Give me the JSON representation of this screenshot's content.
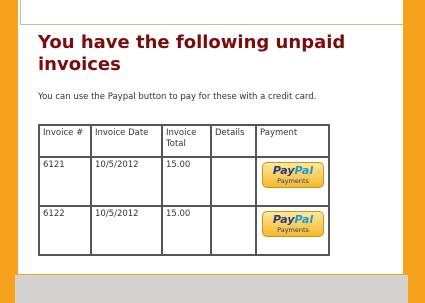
{
  "page": {
    "title": "You have the following unpaid invoices",
    "intro": "You can use the Paypal button to pay for these with a credit card."
  },
  "table": {
    "headers": [
      "Invoice #",
      "Invoice Date",
      "Invoice Total",
      "Details",
      "Payment"
    ],
    "rows": [
      {
        "invoice": "6121",
        "date": "10/5/2012",
        "total": "15.00",
        "details": ""
      },
      {
        "invoice": "6122",
        "date": "10/5/2012",
        "total": "15.00",
        "details": ""
      }
    ]
  },
  "paypal": {
    "pay": "Pay",
    "pal": "Pal",
    "sub": "Payments"
  },
  "colors": {
    "background": "#f7a21c",
    "title": "#7b0c0c"
  }
}
